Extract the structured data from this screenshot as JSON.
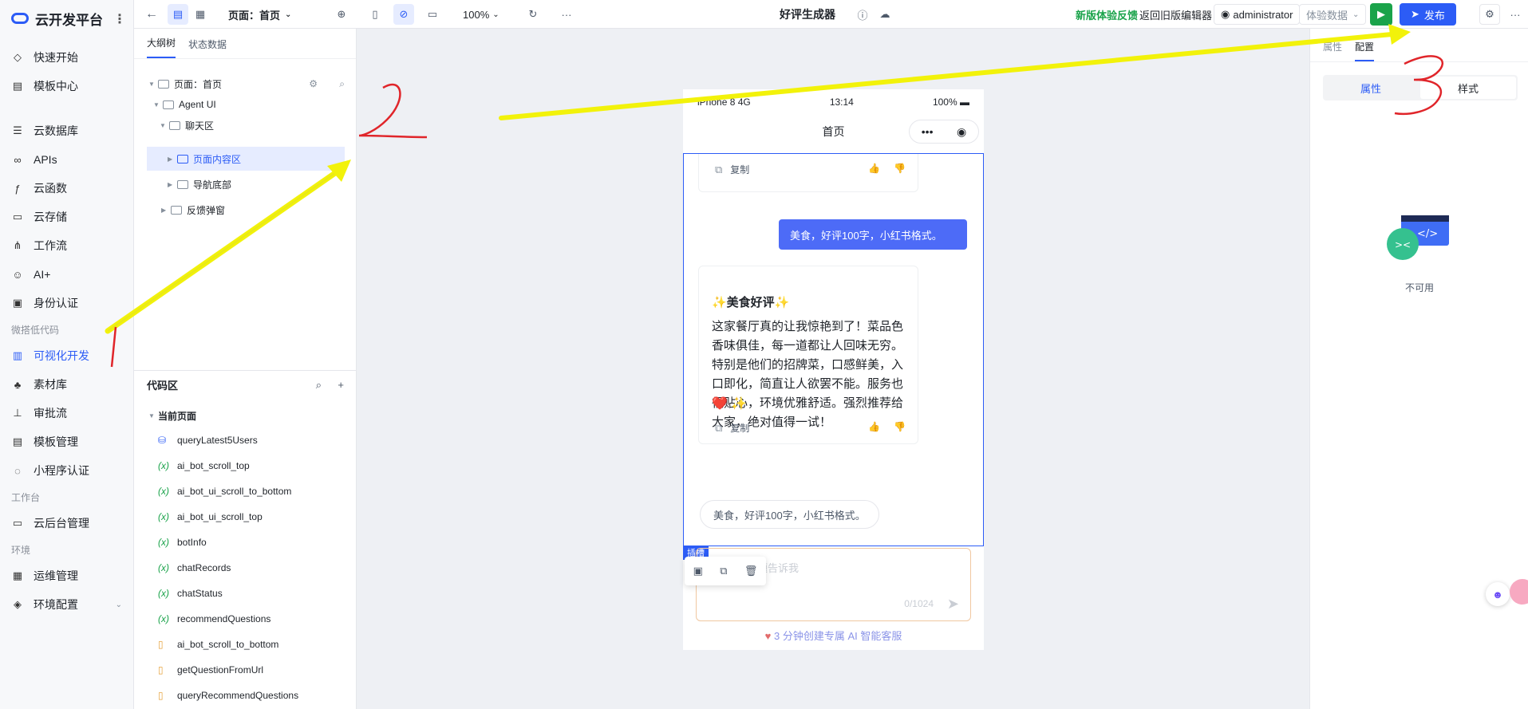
{
  "brand": "云开发平台",
  "nav": {
    "items_top": [
      {
        "label": "快速开始",
        "icon": "rocket-icon"
      },
      {
        "label": "模板中心",
        "icon": "template-icon"
      }
    ],
    "items_mid": [
      {
        "label": "云数据库",
        "icon": "database-icon"
      },
      {
        "label": "APIs",
        "icon": "link-icon"
      },
      {
        "label": "云函数",
        "icon": "function-icon"
      },
      {
        "label": "云存储",
        "icon": "storage-icon"
      },
      {
        "label": "工作流",
        "icon": "workflow-icon"
      },
      {
        "label": "AI+",
        "icon": "robot-icon"
      },
      {
        "label": "身份认证",
        "icon": "id-card-icon"
      }
    ],
    "section_lowcode": "微搭低代码",
    "items_lowcode": [
      {
        "label": "可视化开发",
        "icon": "visual-dev-icon"
      },
      {
        "label": "素材库",
        "icon": "material-icon"
      },
      {
        "label": "审批流",
        "icon": "approval-icon"
      },
      {
        "label": "模板管理",
        "icon": "template-manage-icon"
      },
      {
        "label": "小程序认证",
        "icon": "miniprogram-icon"
      }
    ],
    "section_workbench": "工作台",
    "items_workbench": [
      {
        "label": "云后台管理",
        "icon": "monitor-icon"
      }
    ],
    "section_env": "环境",
    "items_env": [
      {
        "label": "运维管理",
        "icon": "ops-icon"
      },
      {
        "label": "环境配置",
        "icon": "env-config-icon"
      }
    ]
  },
  "topbar": {
    "page_select": "页面：首页",
    "zoom": "100%",
    "app_title": "好评生成器",
    "feedback": "新版体验反馈",
    "back_old": "返回旧版编辑器",
    "user": "administrator",
    "data_select": "体验数据",
    "publish": "发布"
  },
  "outline": {
    "tab_tree": "大纲树",
    "tab_state": "状态数据",
    "nodes": [
      "页面：首页",
      "Agent UI",
      "聊天区",
      "页面内容区",
      "导航底部",
      "反馈弹窗"
    ],
    "code_title": "代码区",
    "code_group": "当前页面",
    "code_items": [
      {
        "name": "queryLatest5Users",
        "kind": "db"
      },
      {
        "name": "ai_bot_scroll_top",
        "kind": "var"
      },
      {
        "name": "ai_bot_ui_scroll_to_bottom",
        "kind": "var"
      },
      {
        "name": "ai_bot_ui_scroll_top",
        "kind": "var"
      },
      {
        "name": "botInfo",
        "kind": "var"
      },
      {
        "name": "chatRecords",
        "kind": "var"
      },
      {
        "name": "chatStatus",
        "kind": "var"
      },
      {
        "name": "recommendQuestions",
        "kind": "var"
      },
      {
        "name": "ai_bot_scroll_to_bottom",
        "kind": "fn"
      },
      {
        "name": "getQuestionFromUrl",
        "kind": "fn"
      },
      {
        "name": "queryRecommendQuestions",
        "kind": "fn"
      }
    ]
  },
  "phone": {
    "carrier": "iPhone 8  4G",
    "time": "13:14",
    "battery": "100%",
    "nav_title": "首页",
    "copy_label": "复制",
    "user_msg": "美食，好评100字，小红书格式。",
    "bot_title": "✨美食好评✨",
    "bot_body": "这家餐厅真的让我惊艳到了！菜品色香味俱佳，每一道都让人回味无穷。特别是他们的招牌菜，口感鲜美，入口即化，简直让人欲罢不能。服务也很贴心，环境优雅舒适。强烈推荐给大家，绝对值得一试！",
    "bot_emojis": "❤️ ✨",
    "suggestion": "美食，好评100字，小红书格式。",
    "slot_tag": "插槽",
    "input_placeholder": "把问题告诉我",
    "counter": "0/1024",
    "footer_link": "3 分钟创建专属 AI 智能客服"
  },
  "right": {
    "tab_props": "属性",
    "tab_config": "配置",
    "seg_attr": "属性",
    "seg_style": "样式",
    "unavailable": "不可用"
  },
  "colors": {
    "accent": "#2c5cf6",
    "green": "#1aa34a",
    "annotation_red": "#e0252a",
    "annotation_yellow": "#f2f20a"
  }
}
